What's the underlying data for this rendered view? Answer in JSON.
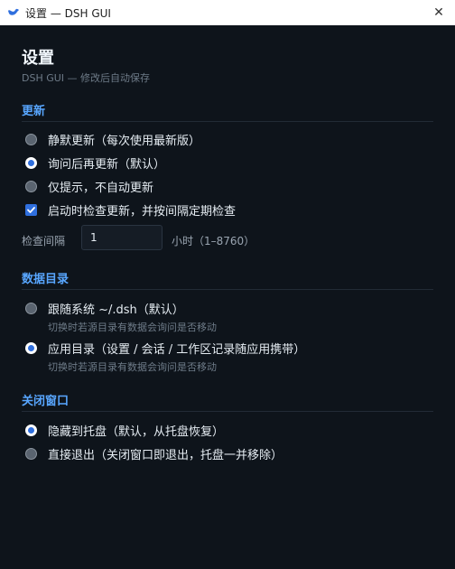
{
  "window": {
    "title": "设置 — DSH GUI",
    "close_glyph": "✕"
  },
  "header": {
    "title": "设置",
    "subtitle": "DSH GUI — 修改后自动保存"
  },
  "sections": {
    "update": {
      "title": "更新",
      "options": [
        {
          "label": "静默更新（每次使用最新版）",
          "checked": false
        },
        {
          "label": "询问后再更新（默认）",
          "checked": true
        },
        {
          "label": "仅提示，不自动更新",
          "checked": false
        }
      ],
      "check_on_start": {
        "label": "启动时检查更新，并按间隔定期检查",
        "checked": true
      },
      "interval": {
        "label": "检查间隔",
        "value": "1",
        "unit": "小时（1–8760）"
      }
    },
    "data_dir": {
      "title": "数据目录",
      "options": [
        {
          "label": "跟随系统 ~/.dsh（默认）",
          "hint": "切换时若源目录有数据会询问是否移动",
          "checked": false
        },
        {
          "label": "应用目录（设置 / 会话 / 工作区记录随应用携带）",
          "hint": "切换时若源目录有数据会询问是否移动",
          "checked": true
        }
      ]
    },
    "close_window": {
      "title": "关闭窗口",
      "options": [
        {
          "label": "隐藏到托盘（默认，从托盘恢复）",
          "checked": true
        },
        {
          "label": "直接退出（关闭窗口即退出，托盘一并移除）",
          "checked": false
        }
      ]
    }
  },
  "colors": {
    "accent": "#58a6ff",
    "background": "#0e141b",
    "radio_checked": "#2f6fde"
  }
}
